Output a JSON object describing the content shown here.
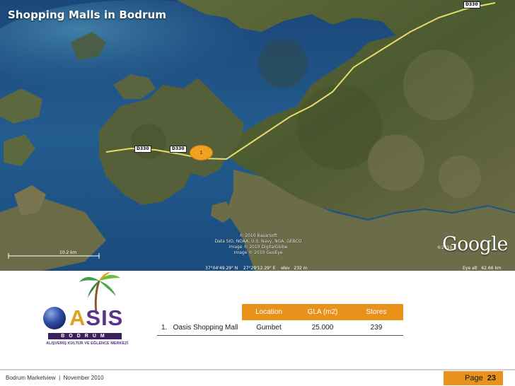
{
  "title": "Shopping Malls in Bodrum",
  "map": {
    "copyright_lines": [
      "© 2010 Basarsoft",
      "Data SIO, NOAA, U.S. Navy, NGA, GEBCO",
      "Image © 2010 DigitalGlobe",
      "Image © 2010 GeoEye"
    ],
    "google_logo": "Google",
    "google_year": "©2010",
    "coordinates": "37°04'49.29\" N    27°29'12.29\" E    elev   232 m",
    "eye_alt": "Eye alt   62.66 km",
    "scale_label": "10.2 km",
    "road_labels": [
      "D330",
      "D330",
      "D330"
    ],
    "marker_label": "1"
  },
  "logo": {
    "brand": "OASIS",
    "city": "BODRUM",
    "tagline": "ALIŞVERİŞ KÜLTÜR VE EĞLENCE MERKEZİ"
  },
  "table": {
    "headers": [
      "",
      "Location",
      "GLA (m2)",
      "Stores"
    ],
    "rows": [
      {
        "name": "1.   Oasis Shopping Mall",
        "location": "Gumbet",
        "gla": "25.000",
        "stores": "239"
      }
    ]
  },
  "footer": {
    "text": "Bodrum Marketview  |  November 2010",
    "page_label": "Page",
    "page_number": "23"
  }
}
